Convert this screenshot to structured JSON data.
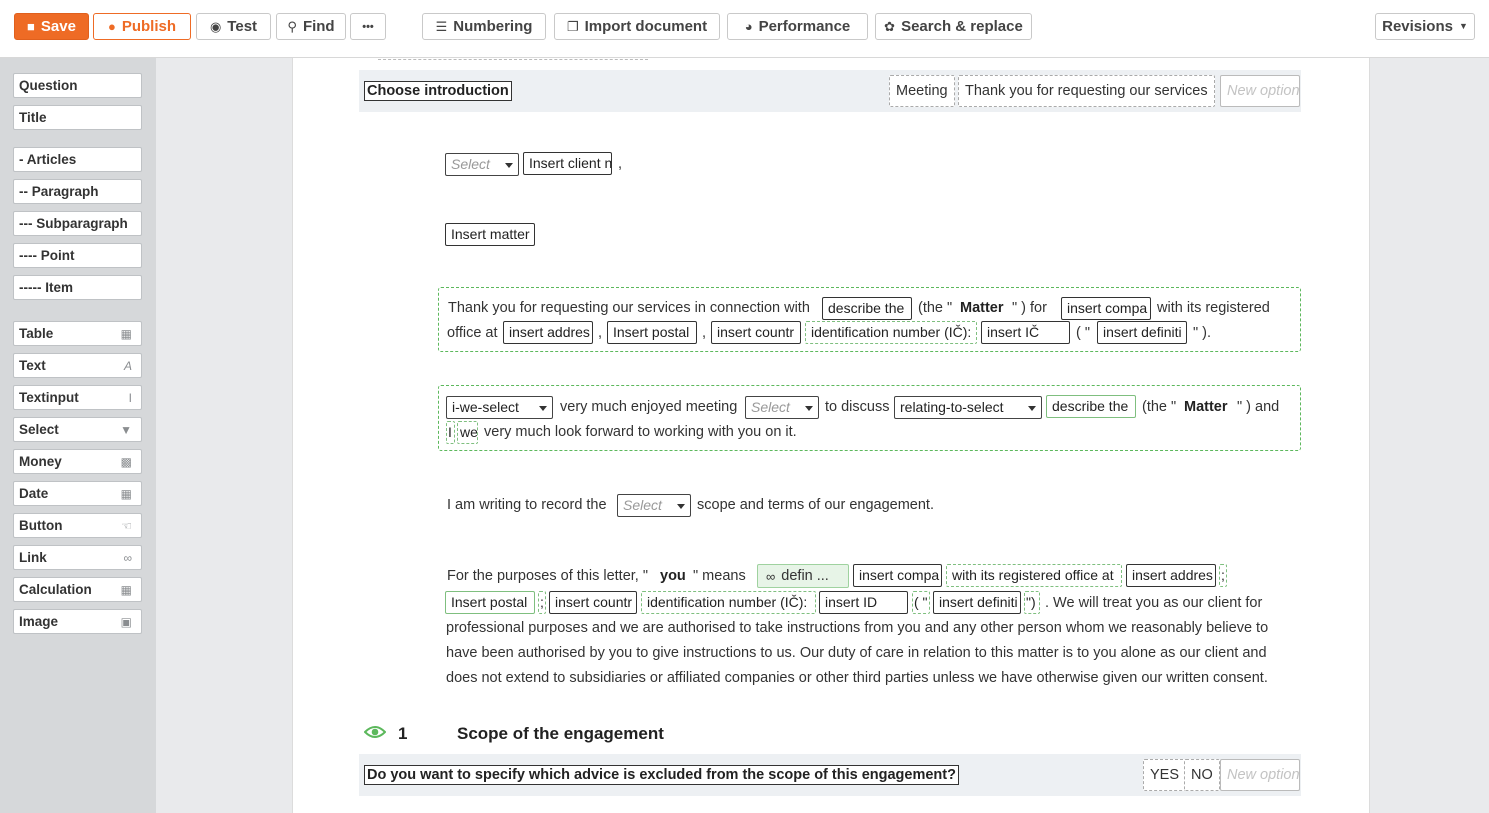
{
  "toolbar": {
    "save": "Save",
    "publish": "Publish",
    "test": "Test",
    "find": "Find",
    "more": "•••",
    "numbering": "Numbering",
    "import": "Import document",
    "performance": "Performance",
    "search_replace": "Search & replace",
    "revisions": "Revisions"
  },
  "sidebar": {
    "structure": [
      "Question",
      "Title"
    ],
    "levels": [
      "- Articles",
      "-- Paragraph",
      "--- Subparagraph",
      "---- Point",
      "----- Item"
    ],
    "fields": [
      "Table",
      "Text",
      "Textinput",
      "Select",
      "Money",
      "Date",
      "Button",
      "Link",
      "Calculation",
      "Image"
    ]
  },
  "question1": {
    "label": "Choose introduction",
    "options": [
      "Meeting",
      "Thank you for requesting our services"
    ],
    "new_option": "New option"
  },
  "salutation": {
    "select_placeholder": "Select",
    "client_name": "Insert client n",
    "comma": ","
  },
  "matter_field": "Insert matter",
  "para_thankyou": {
    "t1": "Thank you for requesting our services in connection with",
    "f_describe": "describe the",
    "t2": "(the \"",
    "matter_bold": "Matter",
    "t3": "\" ) for",
    "f_company": "insert compa",
    "t4": "with its registered",
    "t5": "office at",
    "f_address": "insert addres",
    "comma1": ",",
    "f_postal": "Insert postal",
    "comma2": ",",
    "f_country": "insert countr",
    "f_idnum": "identification number (IČ):",
    "f_ic": "insert IČ",
    "t6": "( \"",
    "f_definition": "insert definiti",
    "t7": "\" )."
  },
  "para_meeting": {
    "f_iwe": "i-we-select",
    "t1": "very much enjoyed meeting",
    "f_select": "Select",
    "t2": "to discuss",
    "f_relating": "relating-to-select",
    "f_describe": "describe the",
    "t3": "(the \"",
    "matter_bold": "Matter",
    "t4": "\" ) and",
    "f_i": "I",
    "f_we": "we",
    "t5": "very much look forward to working with you on it."
  },
  "para_record": {
    "t1": "I am writing to record the",
    "f_select": "Select",
    "t2": "scope and terms of our engagement."
  },
  "para_you": {
    "t1": "For the purposes of this letter, \"",
    "you_bold": "you",
    "t2": "\" means",
    "link": "defin ...",
    "f_company": "insert compa",
    "f_regoffice": "with its registered office at",
    "f_address": "insert addres",
    "semi1": ";",
    "f_postal": "Insert postal",
    "semi2": ";",
    "f_country": "insert countr",
    "f_idnum": "identification number (IČ):",
    "f_id": "insert ID",
    "f_quote_open": "( \"",
    "f_definition": "insert definiti",
    "f_quote_close": "\")",
    "t3": ". We will treat you as our client for",
    "l2": "professional purposes and we are authorised to take instructions from you and any other person whom we reasonably believe to",
    "l3": "have been authorised by you to give instructions to us. Our duty of care in relation to this matter is to you alone as our client and",
    "l4": "does not extend to subsidiaries or affiliated companies or other third parties unless we have otherwise given our written consent."
  },
  "section1": {
    "number": "1",
    "title": "Scope of the engagement"
  },
  "question2": {
    "label": "Do you want to specify which advice is excluded from the scope of this engagement?",
    "options": [
      "YES",
      "NO"
    ],
    "new_option": "New option"
  },
  "colors": {
    "accent": "#ee6b25",
    "condition_border": "#5cb85c",
    "sidebar_bg": "#d6d8da"
  }
}
